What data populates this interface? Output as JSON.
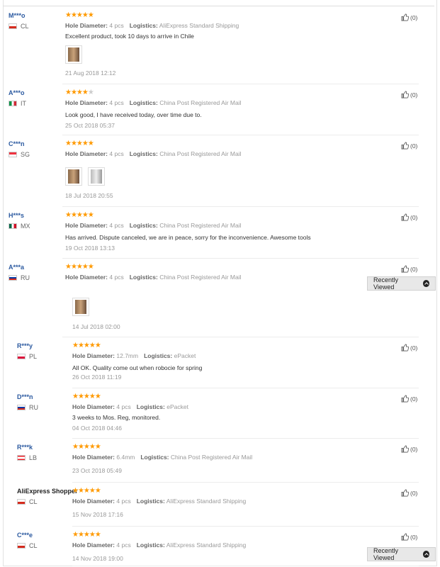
{
  "reviews": [
    {
      "name": "M***o",
      "country": "CL",
      "stars": 5,
      "hole_label": "Hole Diameter:",
      "hole": "4 pcs",
      "log_label": "Logistics:",
      "logistics": "AliExpress Standard Shipping",
      "text": "Excellent product, took 10 days to arrive in Chile",
      "date": "21 Aug 2018 12:12",
      "likes": "(0)",
      "photos": 1
    },
    {
      "name": "A***o",
      "country": "IT",
      "stars": 4,
      "hole_label": "Hole Diameter:",
      "hole": "4 pcs",
      "log_label": "Logistics:",
      "logistics": "China Post Registered Air Mail",
      "text": "Look good, I have received today, over time due to.",
      "date": "25 Oct 2018 05:37",
      "likes": "(0)",
      "photos": 0
    },
    {
      "name": "C***n",
      "country": "SG",
      "stars": 5,
      "hole_label": "Hole Diameter:",
      "hole": "4 pcs",
      "log_label": "Logistics:",
      "logistics": "China Post Registered Air Mail",
      "text": "",
      "date": "18 Jul 2018 20:55",
      "likes": "(0)",
      "photos": 2
    },
    {
      "name": "H***s",
      "country": "MX",
      "stars": 5,
      "hole_label": "Hole Diameter:",
      "hole": "4 pcs",
      "log_label": "Logistics:",
      "logistics": "China Post Registered Air Mail",
      "text": "Has arrived. Dispute canceled, we are in peace, sorry for the inconvenience. Awesome tools",
      "date": "19 Oct 2018 13:13",
      "likes": "(0)",
      "photos": 0
    },
    {
      "name": "A***a",
      "country": "RU",
      "stars": 5,
      "hole_label": "Hole Diameter:",
      "hole": "4 pcs",
      "log_label": "Logistics:",
      "logistics": "China Post Registered Air Mail",
      "text": "",
      "date": "14 Jul 2018 02:00",
      "likes": "(0)",
      "photos": 1
    },
    {
      "name": "R***y",
      "country": "PL",
      "stars": 5,
      "hole_label": "Hole Diameter:",
      "hole": "12.7mm",
      "log_label": "Logistics:",
      "logistics": "ePacket",
      "text": "All OK. Quality come out when robocie for spring",
      "date": "26 Oct 2018 11:19",
      "likes": "(0)",
      "photos": 0
    },
    {
      "name": "D***n",
      "country": "RU",
      "stars": 5,
      "hole_label": "Hole Diameter:",
      "hole": "4 pcs",
      "log_label": "Logistics:",
      "logistics": "ePacket",
      "text": "3 weeks to Mos. Reg, monitored.",
      "date": "04 Oct 2018 04:46",
      "likes": "(0)",
      "photos": 0
    },
    {
      "name": "R***k",
      "country": "LB",
      "stars": 5,
      "hole_label": "Hole Diameter:",
      "hole": "6.4mm",
      "log_label": "Logistics:",
      "logistics": "China Post Registered Air Mail",
      "text": "",
      "date": "23 Oct 2018 05:49",
      "likes": "(0)",
      "photos": 0
    },
    {
      "name": "AliExpress Shopper",
      "country": "CL",
      "stars": 5,
      "hole_label": "Hole Diameter:",
      "hole": "4 pcs",
      "log_label": "Logistics:",
      "logistics": "AliExpress Standard Shipping",
      "text": "",
      "date": "15 Nov 2018 17:16",
      "likes": "(0)",
      "photos": 0
    },
    {
      "name": "C***e",
      "country": "CL",
      "stars": 5,
      "hole_label": "Hole Diameter:",
      "hole": "4 pcs",
      "log_label": "Logistics:",
      "logistics": "AliExpress Standard Shipping",
      "text": "",
      "date": "14 Nov 2018 19:00",
      "likes": "(0)",
      "photos": 0
    }
  ],
  "recently_viewed": "Recently Viewed",
  "colors": {
    "star": "#ff9a00",
    "name": "#2c5aa0",
    "muted": "#999999"
  },
  "icons": {
    "like": "thumbs-up-icon",
    "toggle": "chevron-up-circle-icon"
  }
}
